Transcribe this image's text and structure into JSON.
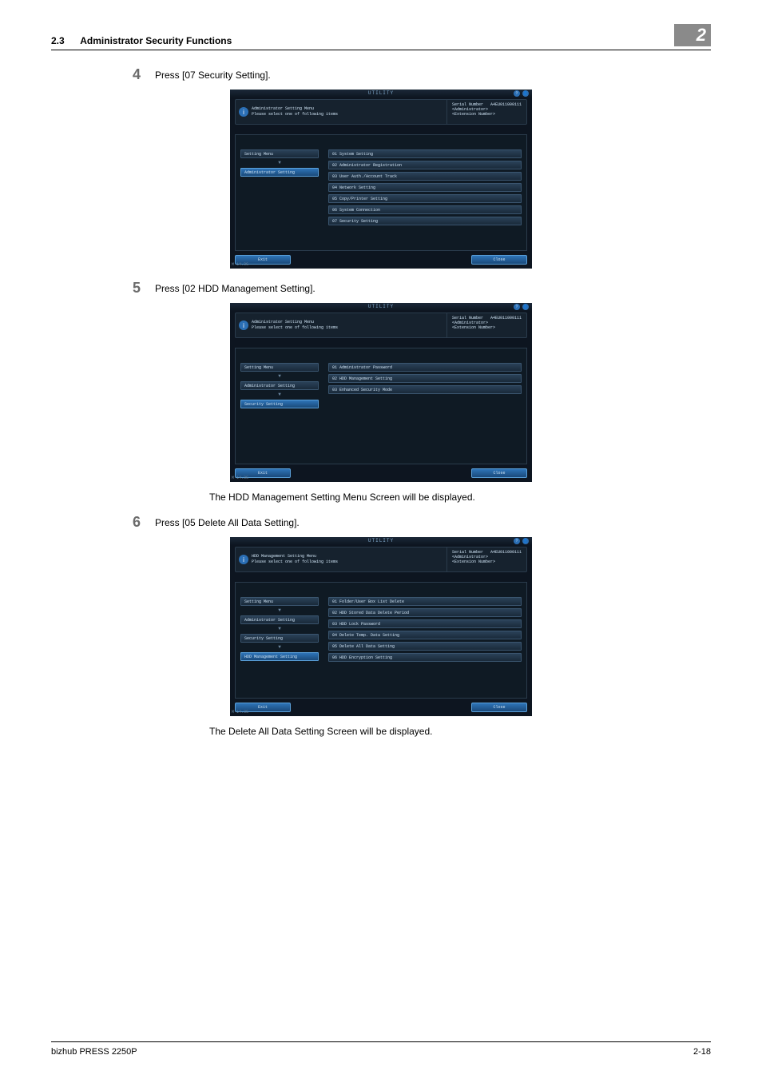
{
  "header": {
    "section": "2.3",
    "title": "Administrator Security Functions",
    "chapter": "2"
  },
  "steps": {
    "s4": {
      "num": "4",
      "text": "Press [07 Security Setting]."
    },
    "s5": {
      "num": "5",
      "text": "Press [02 HDD Management Setting]."
    },
    "s5_after": "The HDD Management Setting Menu Screen will be displayed.",
    "s6": {
      "num": "6",
      "text": "Press [05 Delete All Data Setting]."
    },
    "s6_after": "The Delete All Data Setting Screen will be displayed."
  },
  "common": {
    "title": "UTILITY",
    "serial_label": "Serial Number",
    "serial_value": "A4EU011000111",
    "admin": "<Administrator>",
    "ext": "<Extension Number>",
    "exit": "Exit",
    "close": "Close",
    "memory": "M 14.3G",
    "info_glyph": "i",
    "help_glyph": "?",
    "person_glyph": "👤"
  },
  "screen1": {
    "header_line1": "Administrator Setting Menu",
    "header_line2": "Please select one of following items",
    "left": [
      {
        "label": "Setting Menu",
        "highlight": false
      },
      {
        "label": "Administrator Setting",
        "highlight": true
      }
    ],
    "right": [
      "01 System Setting",
      "02 Administrator Registration",
      "03 User Auth./Account Track",
      "04 Network Setting",
      "05 Copy/Printer Setting",
      "06 System Connection",
      "07 Security Setting"
    ]
  },
  "screen2": {
    "header_line1": "Administrator Setting Menu",
    "header_line2": "Please select one of following items",
    "left": [
      {
        "label": "Setting Menu",
        "highlight": false
      },
      {
        "label": "Administrator Setting",
        "highlight": false
      },
      {
        "label": "Security Setting",
        "highlight": true
      }
    ],
    "right": [
      "01 Administrator Password",
      "02 HDD Management Setting",
      "03 Enhanced Security Mode"
    ]
  },
  "screen3": {
    "header_line1": "HDD Management Setting Menu",
    "header_line2": "Please select one of following items",
    "left": [
      {
        "label": "Setting Menu",
        "highlight": false
      },
      {
        "label": "Administrator Setting",
        "highlight": false
      },
      {
        "label": "Security Setting",
        "highlight": false
      },
      {
        "label": "HDD Management Setting",
        "highlight": true
      }
    ],
    "right": [
      "01 Folder/User Box List Delete",
      "02 HDD Stored Data Delete Period",
      "03 HDD Lock Password",
      "04 Delete Temp. Data Setting",
      "05 Delete All Data Setting",
      "06 HDD Encryption Setting"
    ]
  },
  "footer": {
    "left": "bizhub PRESS 2250P",
    "right": "2-18"
  }
}
